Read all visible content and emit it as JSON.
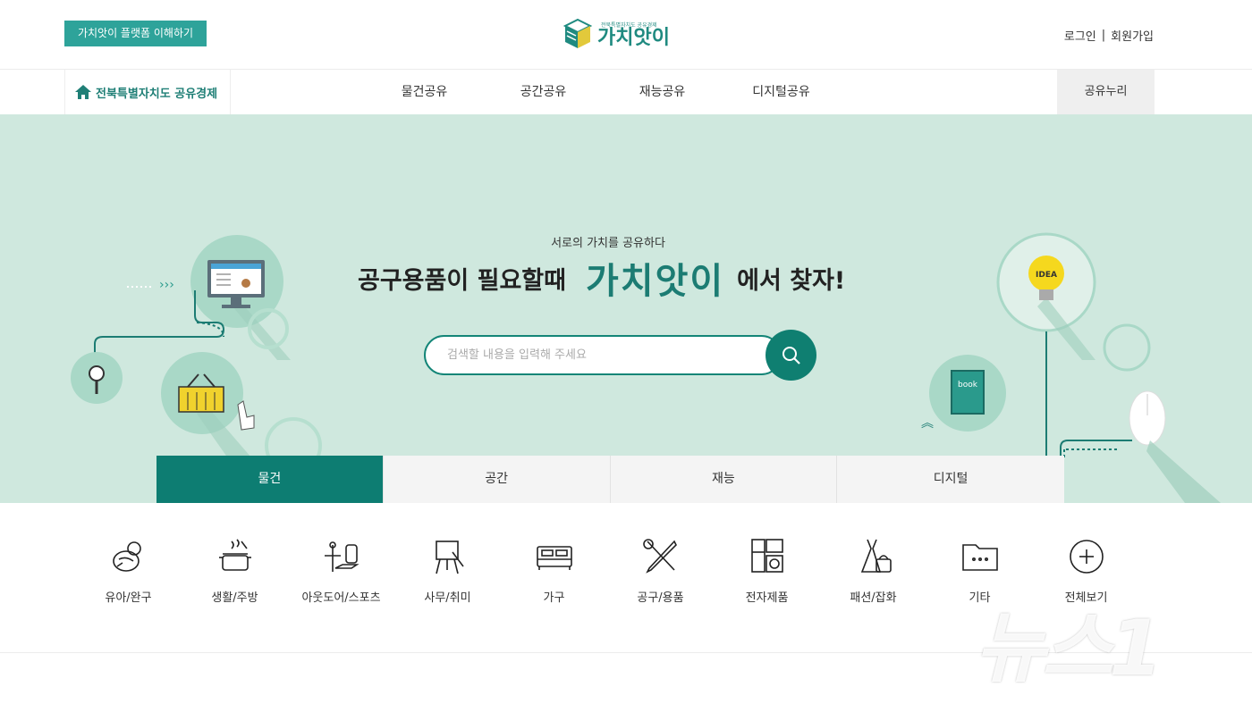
{
  "header": {
    "platform_button": "가치앗이 플랫폼 이해하기",
    "logo_small": "전북특별자치도 공유경제",
    "logo_text": "가치앗이",
    "login": "로그인",
    "separator": "|",
    "signup": "회원가입"
  },
  "nav": {
    "region": "전북특별자치도 공유경제",
    "items": [
      {
        "label": "물건공유"
      },
      {
        "label": "공간공유"
      },
      {
        "label": "재능공유"
      },
      {
        "label": "디지털공유"
      }
    ],
    "right_item": "공유누리"
  },
  "hero": {
    "tagline": "서로의 가치를 공유하다",
    "headline_before": "공구용품이 필요할때",
    "headline_brand": "가치앗이",
    "headline_after": "에서 찾자!",
    "search_placeholder": "검색할 내용을 입력해 주세요",
    "idea_label": "IDEA",
    "book_label": "book"
  },
  "tabs": [
    {
      "label": "물건",
      "active": true
    },
    {
      "label": "공간",
      "active": false
    },
    {
      "label": "재능",
      "active": false
    },
    {
      "label": "디지털",
      "active": false
    }
  ],
  "categories": [
    {
      "label": "유아/완구",
      "icon": "baby-icon"
    },
    {
      "label": "생활/주방",
      "icon": "pot-icon"
    },
    {
      "label": "아웃도어/스포츠",
      "icon": "outdoor-icon"
    },
    {
      "label": "사무/취미",
      "icon": "easel-icon"
    },
    {
      "label": "가구",
      "icon": "bed-icon"
    },
    {
      "label": "공구/용품",
      "icon": "tools-icon"
    },
    {
      "label": "전자제품",
      "icon": "appliance-icon"
    },
    {
      "label": "패션/잡화",
      "icon": "fashion-icon"
    },
    {
      "label": "기타",
      "icon": "folder-icon"
    },
    {
      "label": "전체보기",
      "icon": "plus-circle-icon"
    }
  ],
  "watermark": "뉴스1",
  "colors": {
    "primary": "#0d7d72",
    "hero_bg": "#cfe8de",
    "button_teal": "#2ea39a"
  }
}
